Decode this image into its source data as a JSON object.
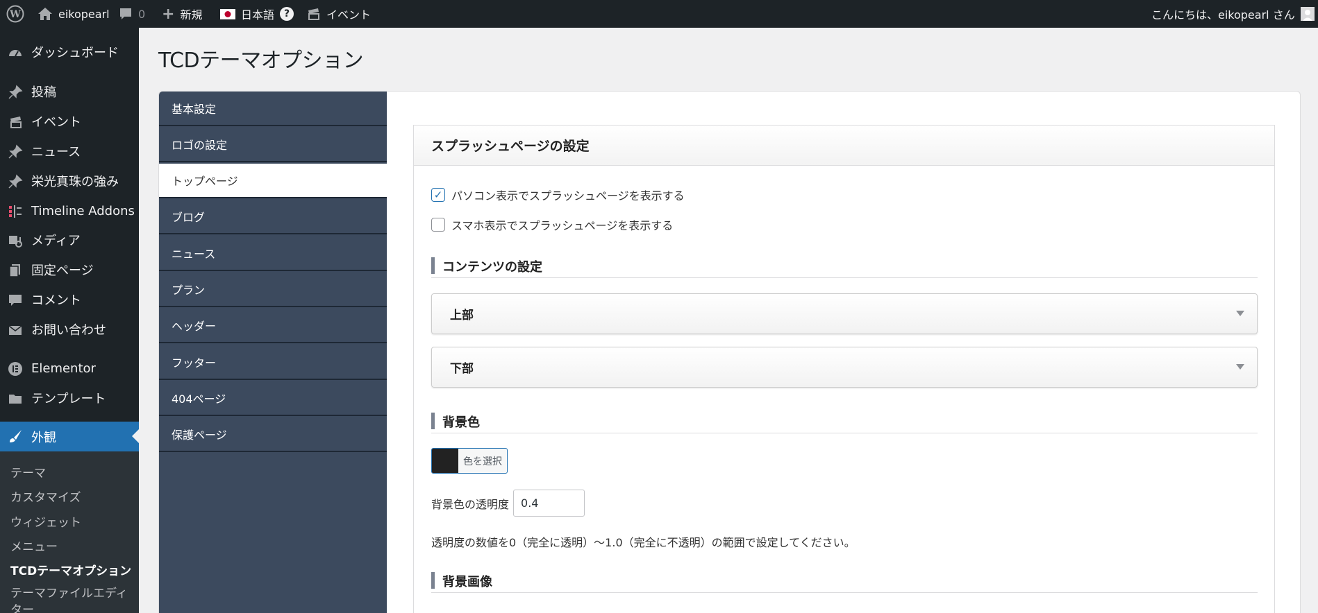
{
  "adminbar": {
    "site_name": "eikopearl",
    "comments_count": "0",
    "new_label": "新規",
    "language_label": "日本語",
    "help_label": "?",
    "event_label": "イベント",
    "greeting": "こんにちは、eikopearl さん"
  },
  "menu": {
    "dashboard": "ダッシュボード",
    "posts": "投稿",
    "events": "イベント",
    "news": "ニュース",
    "strengths": "栄光真珠の強み",
    "timeline": "Timeline Addons",
    "media": "メディア",
    "pages": "固定ページ",
    "comments": "コメント",
    "contact": "お問い合わせ",
    "elementor": "Elementor",
    "templates": "テンプレート",
    "appearance": "外観"
  },
  "submenu": {
    "themes": "テーマ",
    "customize": "カスタマイズ",
    "widgets": "ウィジェット",
    "menus": "メニュー",
    "tcd": "TCDテーマオプション",
    "editor": "テーマファイルエディター"
  },
  "page_title": "TCDテーマオプション",
  "tabs": {
    "basic": "基本設定",
    "logo": "ロゴの設定",
    "top": "トップページ",
    "blog": "ブログ",
    "news": "ニュース",
    "plan": "プラン",
    "header": "ヘッダー",
    "footer": "フッター",
    "page404": "404ページ",
    "protected": "保護ページ"
  },
  "content": {
    "heading": "スプラッシュページの設定",
    "pc_splash": {
      "label": "パソコン表示でスプラッシュページを表示する",
      "checked": true
    },
    "sp_splash": {
      "label": "スマホ表示でスプラッシュページを表示する",
      "checked": false
    },
    "contents_heading": "コンテンツの設定",
    "upper": "上部",
    "lower": "下部",
    "bg_color_heading": "背景色",
    "bg_color_value": "#222222",
    "color_button_label": "色を選択",
    "opacity_label": "背景色の透明度",
    "opacity_value": "0.4",
    "opacity_note": "透明度の数値を0（完全に透明）〜1.0（完全に不透明）の範囲で設定してください。",
    "bg_image_heading": "背景画像"
  }
}
